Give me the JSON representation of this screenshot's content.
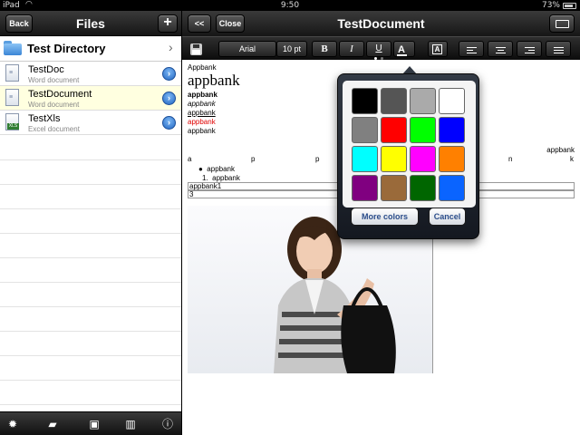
{
  "status_bar": {
    "carrier": "iPad",
    "time": "9:50",
    "battery": "73%"
  },
  "left_panel": {
    "title": "Files",
    "back_label": "Back",
    "add_label": "+",
    "directory": {
      "name": "Test Directory"
    },
    "files": [
      {
        "name": "TestDoc",
        "type": "Word document",
        "icon": "word-doc-icon",
        "selected": false
      },
      {
        "name": "TestDocument",
        "type": "Word document",
        "icon": "word-doc-icon",
        "selected": true
      },
      {
        "name": "TestXls",
        "type": "Excel document",
        "icon": "excel-doc-icon",
        "selected": false
      }
    ],
    "toolbar_icons": [
      "gear-icon",
      "new-folder-icon",
      "import-folder-icon",
      "trash-icon",
      "info-icon"
    ]
  },
  "right_panel": {
    "title": "TestDocument",
    "prev_label": "<<",
    "close_label": "Close",
    "format_bar": {
      "font_name": "Arial",
      "font_size": "10 pt",
      "bold": "B",
      "italic": "I",
      "underline": "U",
      "font_color": "A",
      "highlight": "A"
    },
    "document": {
      "lines": [
        "Appbank",
        "appbank",
        "appbank",
        "appbank",
        "appbank",
        "appbank",
        "appbank"
      ],
      "right_text": "appbank",
      "spread_letters": [
        "a",
        "p",
        "p",
        "b",
        "a",
        "n",
        "k"
      ],
      "bullet_item": "appbank",
      "numbered_marker": "1.",
      "numbered_item": "appbank",
      "table_cells": [
        "appbank1",
        "3"
      ]
    }
  },
  "color_picker": {
    "colors": [
      "#000000",
      "#555555",
      "#aaaaaa",
      "#ffffff",
      "#808080",
      "#ff0000",
      "#00ff00",
      "#0000ff",
      "#00ffff",
      "#ffff00",
      "#ff00ff",
      "#ff8000",
      "#800080",
      "#9a6a3a",
      "#006600",
      "#0a64ff"
    ],
    "more_label": "More colors",
    "cancel_label": "Cancel"
  }
}
